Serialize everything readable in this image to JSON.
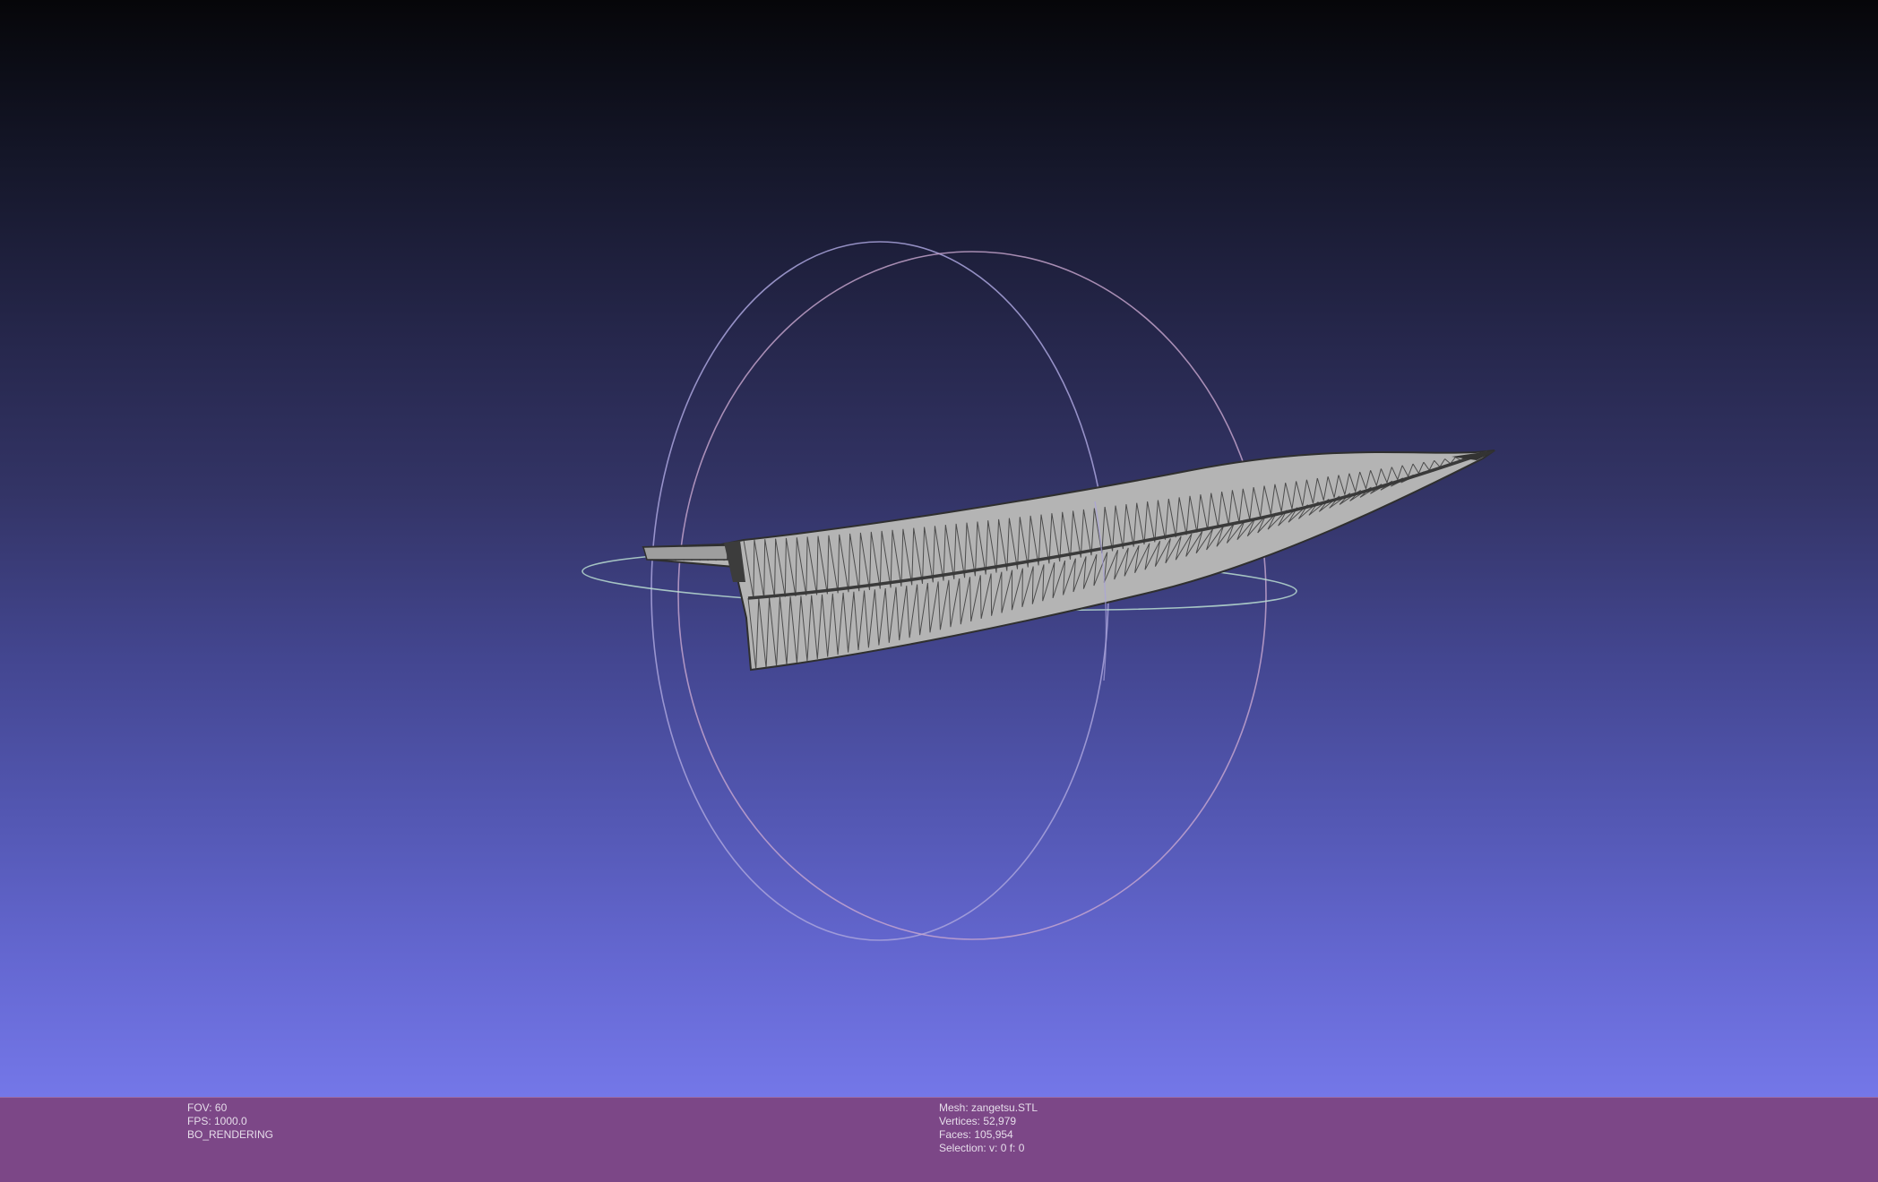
{
  "viewer": {
    "background_top": "#060609",
    "background_bottom": "#7477e8",
    "status_bar_color": "#7c4787"
  },
  "status_left": {
    "fov": "FOV: 60",
    "fps": "FPS:  1000.0",
    "mode": "BO_RENDERING"
  },
  "status_right": {
    "mesh": "Mesh: zangetsu.STL",
    "vertices": "Vertices: 52,979",
    "faces": "Faces: 105,954",
    "selection": "Selection: v: 0 f: 0"
  },
  "trackball": {
    "ring_color_a": "#b9b3e8",
    "ring_color_b": "#d9b0d6",
    "ring_color_horizontal": "#bfe3d8"
  },
  "mesh": {
    "fill_color": "#b4b4b4",
    "edge_color": "#3a3a3a"
  }
}
